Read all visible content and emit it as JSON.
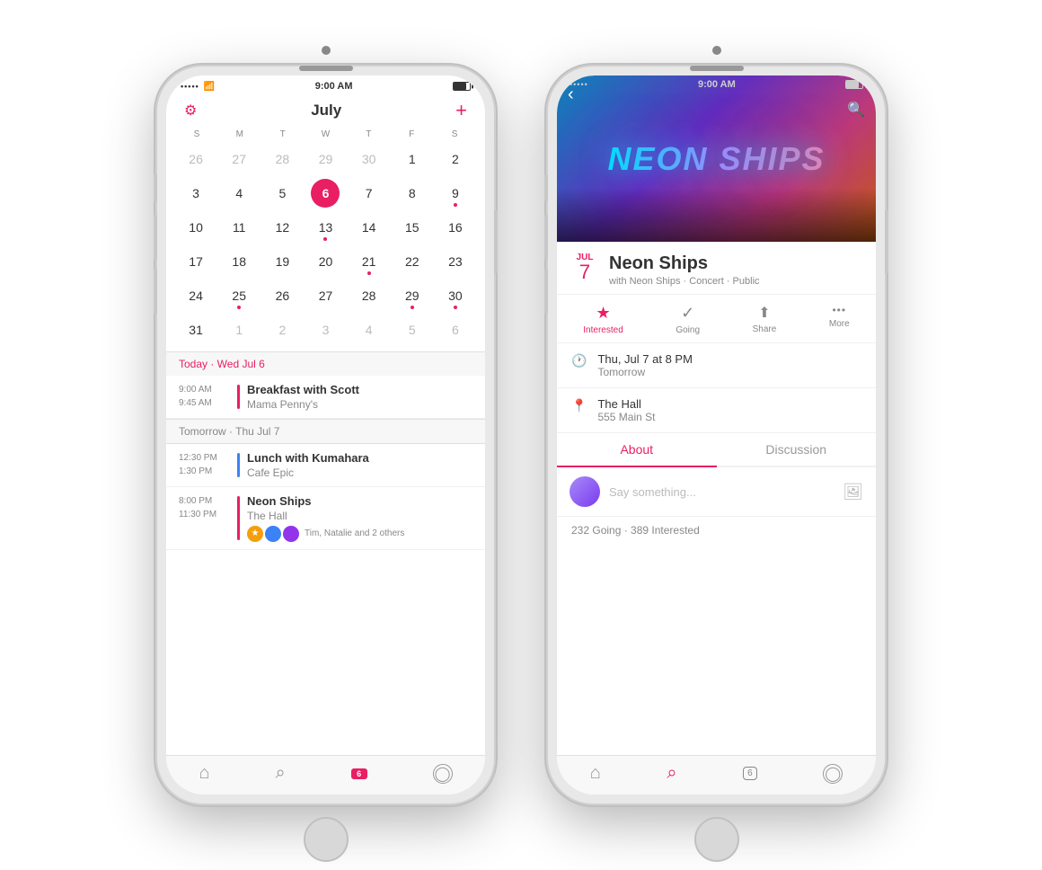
{
  "left_phone": {
    "status": {
      "dots": "•••••",
      "wifi": "wifi",
      "time": "9:00 AM",
      "battery": "battery"
    },
    "header": {
      "gear": "⚙",
      "month": "July",
      "add": "+"
    },
    "calendar": {
      "day_headers": [
        "S",
        "M",
        "T",
        "W",
        "T",
        "F",
        "S"
      ],
      "weeks": [
        [
          {
            "num": "26",
            "other": true
          },
          {
            "num": "27",
            "other": true
          },
          {
            "num": "28",
            "other": true
          },
          {
            "num": "29",
            "other": true
          },
          {
            "num": "30",
            "other": true
          },
          {
            "num": "1",
            "dot": false
          },
          {
            "num": "2",
            "dot": false
          }
        ],
        [
          {
            "num": "3"
          },
          {
            "num": "4"
          },
          {
            "num": "5"
          },
          {
            "num": "6",
            "today": true,
            "dot": false
          },
          {
            "num": "7",
            "dot": false
          },
          {
            "num": "8",
            "dot": false
          },
          {
            "num": "9",
            "dot": true
          }
        ],
        [
          {
            "num": "10"
          },
          {
            "num": "11"
          },
          {
            "num": "12"
          },
          {
            "num": "13",
            "dot": true
          },
          {
            "num": "14"
          },
          {
            "num": "15"
          },
          {
            "num": "16"
          }
        ],
        [
          {
            "num": "17"
          },
          {
            "num": "18"
          },
          {
            "num": "19"
          },
          {
            "num": "20"
          },
          {
            "num": "21",
            "dot": true
          },
          {
            "num": "22"
          },
          {
            "num": "23"
          }
        ],
        [
          {
            "num": "24"
          },
          {
            "num": "25",
            "dot": true
          },
          {
            "num": "26"
          },
          {
            "num": "27"
          },
          {
            "num": "28"
          },
          {
            "num": "29",
            "dot": true
          },
          {
            "num": "30",
            "dot": true
          }
        ],
        [
          {
            "num": "31"
          },
          {
            "num": "1",
            "other": true
          },
          {
            "num": "2",
            "other": true
          },
          {
            "num": "3",
            "other": true
          },
          {
            "num": "4",
            "other": true
          },
          {
            "num": "5",
            "other": true
          },
          {
            "num": "6",
            "other": true
          }
        ]
      ]
    },
    "today_header": "Today · Wed Jul 6",
    "events_today": [
      {
        "start": "9:00 AM",
        "end": "9:45 AM",
        "title": "Breakfast with Scott",
        "subtitle": "Mama Penny's",
        "color": "pink"
      }
    ],
    "tomorrow_header": "Tomorrow · Thu Jul 7",
    "events_tomorrow": [
      {
        "start": "12:30 PM",
        "end": "1:30 PM",
        "title": "Lunch with Kumahara",
        "subtitle": "Cafe Epic",
        "color": "blue"
      },
      {
        "start": "8:00 PM",
        "end": "11:30 PM",
        "title": "Neon Ships",
        "subtitle": "The Hall",
        "color": "pink",
        "has_attendees": true,
        "attendees_text": "Tim, Natalie and 2 others"
      }
    ],
    "tab_bar": {
      "home": "⌂",
      "search": "⌕",
      "badge": "6",
      "profile": "◯"
    }
  },
  "right_phone": {
    "status": {
      "dots": "•••••",
      "wifi": "wifi",
      "time": "9:00 AM"
    },
    "hero": {
      "text": "NEON SHIPS",
      "back": "‹",
      "search": "🔍"
    },
    "event": {
      "month": "JUL",
      "day": "7",
      "name": "Neon Ships",
      "meta": "with Neon Ships · Concert · Public"
    },
    "actions": {
      "interested": {
        "icon": "★",
        "label": "Interested",
        "active": true
      },
      "going": {
        "icon": "✓",
        "label": "Going",
        "active": false
      },
      "share": {
        "icon": "↗",
        "label": "Share",
        "active": false
      },
      "more": {
        "icon": "•••",
        "label": "More",
        "active": false
      }
    },
    "details": [
      {
        "icon": "🕐",
        "primary": "Thu, Jul 7 at 8 PM",
        "secondary": "Tomorrow"
      },
      {
        "icon": "📍",
        "primary": "The Hall",
        "secondary": "555 Main St"
      }
    ],
    "tabs": [
      "About",
      "Discussion"
    ],
    "active_tab": "About",
    "comment": {
      "placeholder": "Say something...",
      "image_btn": "🖼"
    },
    "stats": "232 Going · 389 Interested",
    "tab_bar": {
      "home": "⌂",
      "search": "⌕",
      "badge": "6",
      "profile": "◯"
    }
  }
}
